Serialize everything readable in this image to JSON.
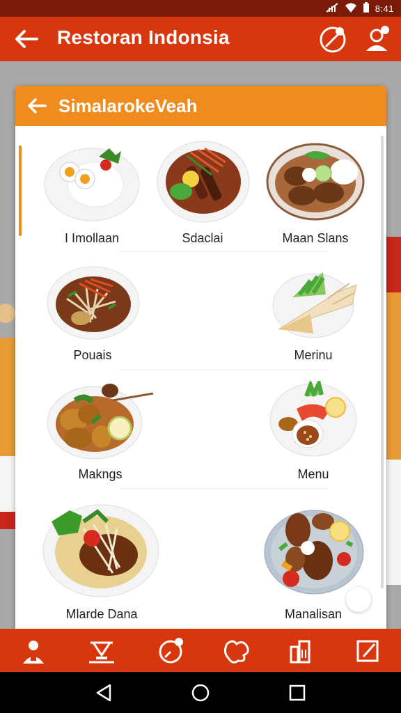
{
  "status_bar": {
    "time": "8:41"
  },
  "app_bar": {
    "title": "Restoran Indonsia"
  },
  "dialog": {
    "title": "SimalarokeVeah"
  },
  "dishes": [
    {
      "label": "I Imollaan",
      "icon": "rice-egg-plate-icon"
    },
    {
      "label": "Sdaclai",
      "icon": "grilled-meat-plate-icon"
    },
    {
      "label": "Maan Slans",
      "icon": "curry-plate-icon"
    },
    {
      "label": "Pouais",
      "icon": "noodle-salad-plate-icon"
    },
    {
      "label": "Merinu",
      "icon": "wrap-plate-icon"
    },
    {
      "label": "Makngs",
      "icon": "satay-plate-icon"
    },
    {
      "label": "Menu",
      "icon": "sambal-plate-icon"
    },
    {
      "label": "Mlarde Dana",
      "icon": "fried-rice-bowl-icon"
    },
    {
      "label": "Manalisan",
      "icon": "chicken-plate-icon"
    }
  ],
  "bottom_nav": [
    "profile-icon",
    "food-tray-icon",
    "timer-icon",
    "map-icon",
    "city-icon",
    "edit-icon"
  ],
  "colors": {
    "primary": "#d8360c",
    "accent": "#f08b1e",
    "status_dark": "#7a1a08"
  }
}
